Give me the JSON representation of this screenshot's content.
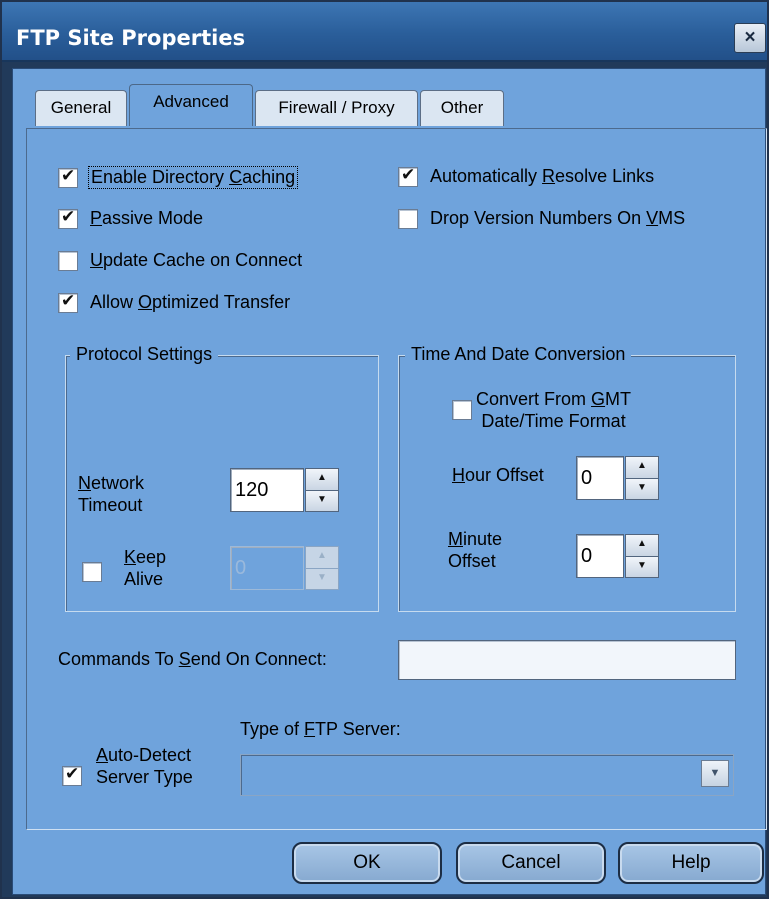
{
  "window": {
    "title": "FTP Site Properties",
    "close_glyph": "×"
  },
  "tabs": [
    {
      "label": "General",
      "active": false
    },
    {
      "label": "Advanced",
      "active": true
    },
    {
      "label": "Firewall / Proxy",
      "active": false
    },
    {
      "label": "Other",
      "active": false
    }
  ],
  "options": {
    "enable_dir_caching": {
      "pre": "Enable Directory ",
      "key": "C",
      "post": "aching",
      "checked": true
    },
    "passive_mode": {
      "pre": "",
      "key": "P",
      "post": "assive Mode",
      "checked": true
    },
    "update_cache": {
      "pre": "",
      "key": "U",
      "post": "pdate Cache on Connect",
      "checked": false
    },
    "allow_optimized": {
      "pre": "Allow ",
      "key": "O",
      "post": "ptimized Transfer",
      "checked": true
    },
    "auto_resolve": {
      "pre": "Automatically ",
      "key": "R",
      "post": "esolve Links",
      "checked": true
    },
    "drop_version": {
      "pre": "Drop Version Numbers On ",
      "key": "V",
      "post": "MS",
      "checked": false
    }
  },
  "protocol": {
    "legend": "Protocol Settings",
    "network_timeout_line1_key": "N",
    "network_timeout_line1_rest": "etwork",
    "network_timeout_line2": "Timeout",
    "network_timeout_value": "120",
    "keep_alive_key": "K",
    "keep_alive_line1_rest": "eep",
    "keep_alive_line2": "Alive",
    "keep_alive_checked": false,
    "keep_alive_value": "0"
  },
  "time_date": {
    "legend": "Time And Date Conversion",
    "convert_line1_pre": "Convert From ",
    "convert_line1_key": "G",
    "convert_line1_post": "MT",
    "convert_line2": "Date/Time Format",
    "convert_checked": false,
    "hour_key": "H",
    "hour_rest": "our Offset",
    "hour_value": "0",
    "minute_key": "M",
    "minute_line1_rest": "inute",
    "minute_line2": "Offset",
    "minute_value": "0"
  },
  "commands": {
    "pre": "Commands To ",
    "key": "S",
    "post": "end On Connect:",
    "value": ""
  },
  "server_type": {
    "label_pre": "Type of ",
    "label_key": "F",
    "label_post": "TP Server:",
    "auto_detect_key": "A",
    "auto_detect_line1_rest": "uto-Detect",
    "auto_detect_line2": "Server Type",
    "auto_detect_checked": true,
    "selected": ""
  },
  "buttons": {
    "ok": "OK",
    "cancel": "Cancel",
    "help": "Help"
  },
  "icons": {
    "spin_up": "▲",
    "spin_down": "▼",
    "dropdown": "▼"
  },
  "colors": {
    "dialog_bg": "#6fa3dc",
    "titlebar": "#2a5e9a",
    "frame": "#213a5a"
  }
}
